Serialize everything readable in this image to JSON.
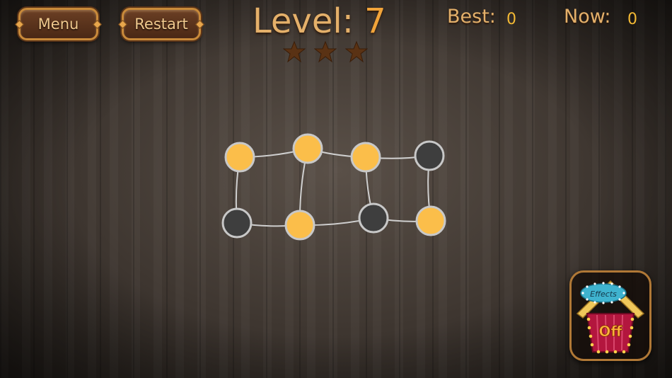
{
  "header": {
    "menu_label": "Menu",
    "restart_label": "Restart",
    "level_label": "Level:",
    "level_number": "7",
    "stars_total": 3,
    "stars_earned": 0,
    "best_label": "Best:",
    "best_value": "0",
    "now_label": "Now:",
    "now_value": "0"
  },
  "board": {
    "nodes": [
      {
        "id": "n1",
        "state": "lit"
      },
      {
        "id": "n2",
        "state": "lit"
      },
      {
        "id": "n3",
        "state": "lit"
      },
      {
        "id": "n4",
        "state": "unlit"
      },
      {
        "id": "n5",
        "state": "unlit"
      },
      {
        "id": "n6",
        "state": "lit"
      },
      {
        "id": "n7",
        "state": "unlit"
      },
      {
        "id": "n8",
        "state": "lit"
      }
    ],
    "edges": [
      [
        "n1",
        "n2"
      ],
      [
        "n2",
        "n3"
      ],
      [
        "n3",
        "n4"
      ],
      [
        "n1",
        "n5"
      ],
      [
        "n2",
        "n6"
      ],
      [
        "n3",
        "n7"
      ],
      [
        "n4",
        "n8"
      ],
      [
        "n5",
        "n6"
      ],
      [
        "n6",
        "n7"
      ],
      [
        "n7",
        "n8"
      ]
    ]
  },
  "effects_toggle": {
    "title": "Effects",
    "state_label": "Off"
  },
  "colors": {
    "lit_node": "#fbbe4a",
    "unlit_node": "#3e3e3e",
    "node_ring": "#c8c8c8",
    "edge": "#cfcfcf",
    "star_empty": "#5a3214"
  }
}
